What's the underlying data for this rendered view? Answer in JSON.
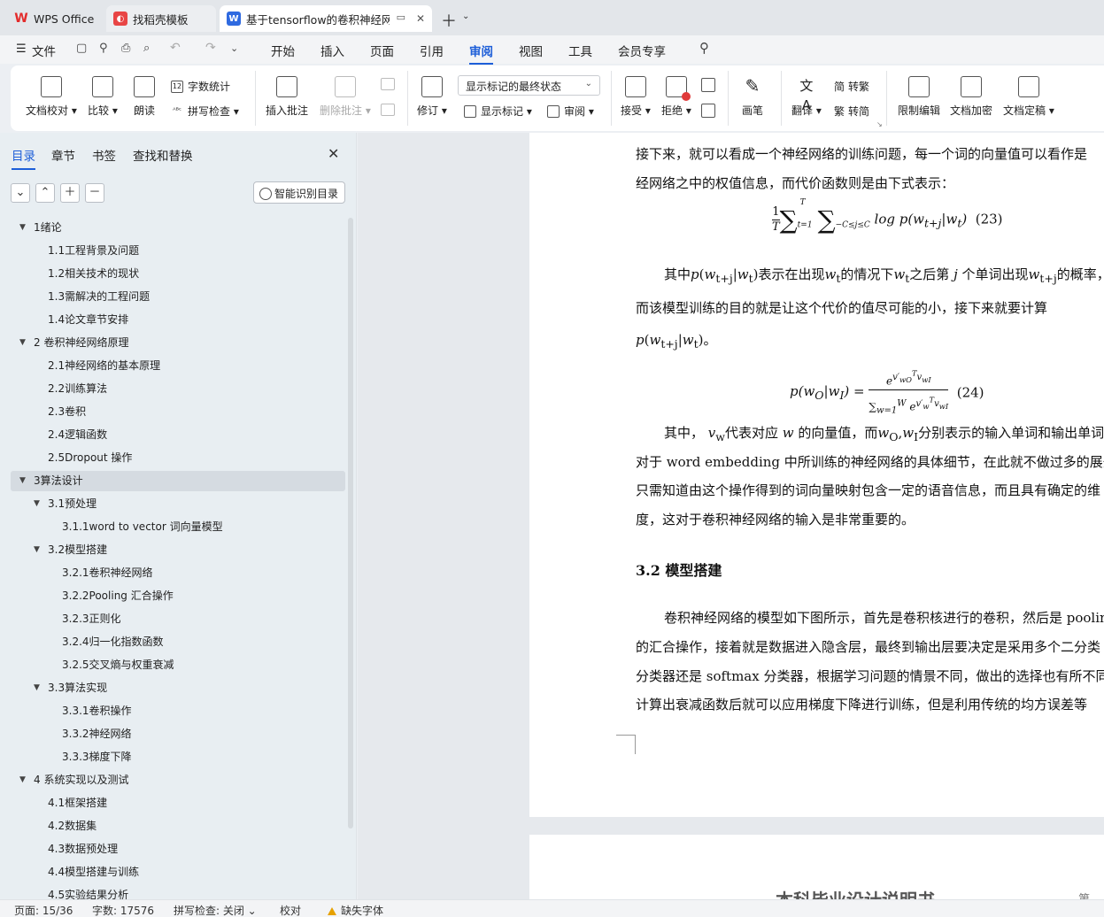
{
  "tabs": [
    {
      "label": "WPS Office",
      "icon": "wps-logo-icon",
      "color": "#e32b2b"
    },
    {
      "label": "找稻壳模板",
      "icon": "docer-logo-icon",
      "color": "#e84545"
    },
    {
      "label": "基于tensorflow的卷积神经网络",
      "icon": "writer-icon",
      "color": "#2f6ae0"
    }
  ],
  "menu": {
    "file": "文件",
    "items": [
      "开始",
      "插入",
      "页面",
      "引用",
      "审阅",
      "视图",
      "工具",
      "会员专享"
    ],
    "active": "审阅"
  },
  "ribbon": {
    "doc_check": "文档校对",
    "compare": "比较",
    "read_aloud": "朗读",
    "word_count": "字数统计",
    "spell_check": "拼写检查",
    "insert_comment": "插入批注",
    "delete_comment": "删除批注",
    "revise": "修订",
    "show_markup_state": "显示标记的最终状态",
    "show_markup": "显示标记",
    "review_pane": "审阅",
    "accept": "接受",
    "reject": "拒绝",
    "pen": "画笔",
    "translate": "翻译",
    "to_trad": "转繁",
    "to_simp": "转简",
    "restrict_edit": "限制编辑",
    "encrypt": "文档加密",
    "finalize": "文档定稿"
  },
  "nav": {
    "tabs": [
      "目录",
      "章节",
      "书签",
      "查找和替换"
    ],
    "active_tab": "目录",
    "smart_toc": "智能识别目录",
    "items": [
      {
        "label": "1绪论",
        "level": 1,
        "expanded": true
      },
      {
        "label": "1.1工程背景及问题",
        "level": 2
      },
      {
        "label": "1.2相关技术的现状",
        "level": 2
      },
      {
        "label": "1.3需解决的工程问题",
        "level": 2
      },
      {
        "label": "1.4论文章节安排",
        "level": 2
      },
      {
        "label": "2 卷积神经网络原理",
        "level": 1,
        "expanded": true
      },
      {
        "label": "2.1神经网络的基本原理",
        "level": 2
      },
      {
        "label": "2.2训练算法",
        "level": 2
      },
      {
        "label": "2.3卷积",
        "level": 2
      },
      {
        "label": "2.4逻辑函数",
        "level": 2
      },
      {
        "label": "2.5Dropout 操作",
        "level": 2
      },
      {
        "label": "3算法设计",
        "level": 1,
        "expanded": true,
        "selected": true
      },
      {
        "label": "3.1预处理",
        "level": 2,
        "expanded": true
      },
      {
        "label": "3.1.1word to vector 词向量模型",
        "level": 3
      },
      {
        "label": "3.2模型搭建",
        "level": 2,
        "expanded": true
      },
      {
        "label": "3.2.1卷积神经网络",
        "level": 3
      },
      {
        "label": "3.2.2Pooling 汇合操作",
        "level": 3
      },
      {
        "label": "3.2.3正则化",
        "level": 3
      },
      {
        "label": "3.2.4归一化指数函数",
        "level": 3
      },
      {
        "label": "3.2.5交叉熵与权重衰减",
        "level": 3
      },
      {
        "label": "3.3算法实现",
        "level": 2,
        "expanded": true
      },
      {
        "label": "3.3.1卷积操作",
        "level": 3
      },
      {
        "label": "3.3.2神经网络",
        "level": 3
      },
      {
        "label": "3.3.3梯度下降",
        "level": 3
      },
      {
        "label": "4 系统实现以及测试",
        "level": 1,
        "expanded": true
      },
      {
        "label": "4.1框架搭建",
        "level": 2
      },
      {
        "label": "4.2数据集",
        "level": 2
      },
      {
        "label": "4.3数据预处理",
        "level": 2
      },
      {
        "label": "4.4模型搭建与训练",
        "level": 2
      },
      {
        "label": "4.5实验结果分析",
        "level": 2
      }
    ]
  },
  "doc": {
    "p1a": "接下来，就可以看成一个神经网络的训练问题，每一个词的向量值可以看作是",
    "p1b": "经网络之中的权值信息，而代价函数则是由下式表示：",
    "eq23_no": "(23)",
    "p2a_1": "其中",
    "p2a_2": "表示在出现",
    "p2a_3": "的情况下",
    "p2a_4": "之后第",
    "p2a_5": "个单词出现",
    "p2a_6": "的概率，",
    "p2b": "而该模型训练的目的就是让这个代价的值尽可能的小，接下来就要计算",
    "eq24_no": "(24)",
    "p3a_1": "其中，",
    "p3a_2": "代表对应",
    "p3a_3": "的向量值，而",
    "p3a_4": "分别表示的输入单词和输出单词",
    "p3b": "对于 word embedding  中所训练的神经网络的具体细节，在此就不做过多的展开",
    "p3c": "只需知道由这个操作得到的词向量映射包含一定的语音信息，而且具有确定的维",
    "p3d": "度，这对于卷积神经网络的输入是非常重要的。",
    "heading": "3.2 模型搭建",
    "p4a": "卷积神经网络的模型如下图所示，首先是卷积核进行的卷积，然后是 pooling",
    "p4b": "的汇合操作，接着就是数据进入隐含层，最终到输出层要决定是采用多个二分类",
    "p4c": "分类器还是 softmax 分类器，根据学习问题的情景不同，做出的选择也有所不同",
    "p4d": "计算出衰减函数后就可以应用梯度下降进行训练，但是利用传统的均方误差等",
    "next_page_title": "本科毕业设计说明书",
    "next_page_right": "第"
  },
  "status": {
    "page": "页面: 15/36",
    "words": "字数: 17576",
    "spell": "拼写检查: 关闭",
    "proof": "校对",
    "missing_font": "缺失字体"
  }
}
